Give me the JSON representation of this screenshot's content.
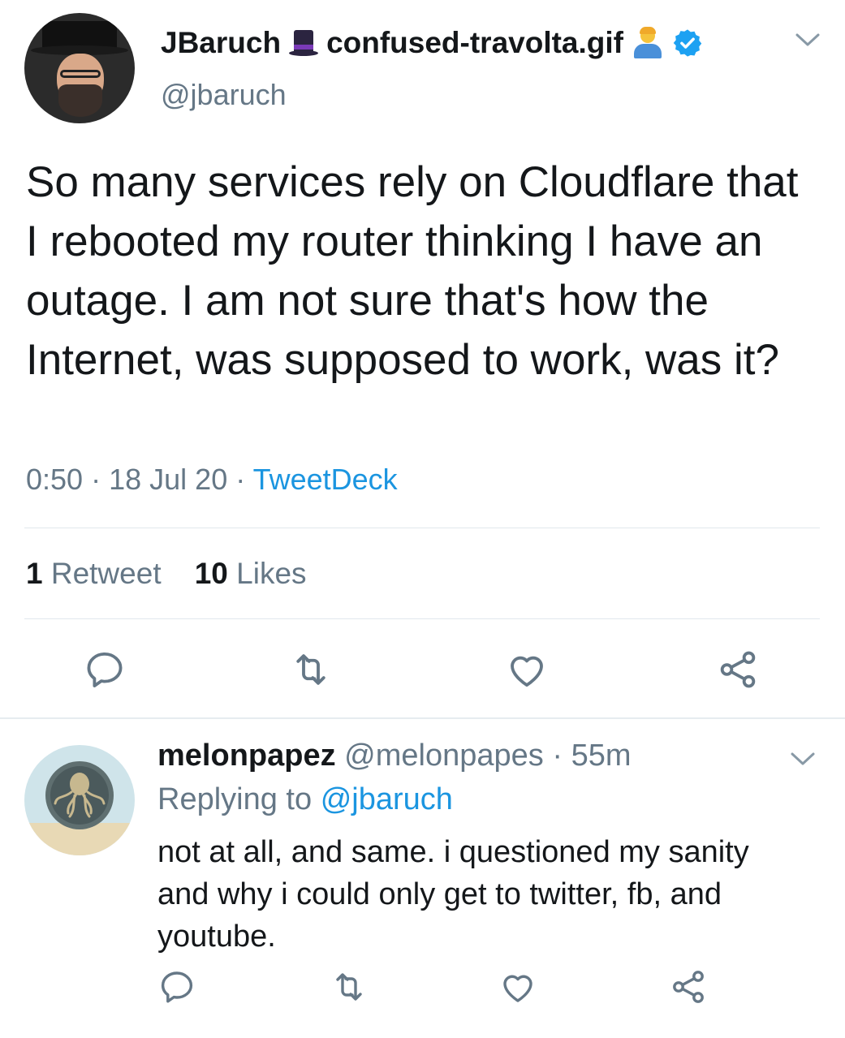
{
  "tweet": {
    "display_name": "JBaruch",
    "display_name_suffix": "confused-travolta.gif",
    "handle": "@jbaruch",
    "text": "So many services rely on Cloudflare that I rebooted my router thinking I have an outage. I am not sure that's how the Internet, was supposed to work, was it?",
    "time": "0:50",
    "date": "18 Jul 20",
    "source": "TweetDeck",
    "separator": "·",
    "retweet_count": "1",
    "retweet_label": "Retweet",
    "like_count": "10",
    "like_label": "Likes",
    "icons": [
      "tophat-icon",
      "person-gesturing-icon",
      "verified-badge-icon",
      "chevron-down-icon",
      "reply-icon",
      "retweet-icon",
      "like-icon",
      "share-icon"
    ]
  },
  "reply": {
    "display_name": "melonpapez",
    "handle": "@melonpapes",
    "separator": "·",
    "age": "55m",
    "replying_prefix": "Replying to",
    "replying_to": "@jbaruch",
    "text": "not at all, and same. i questioned my sanity and why i could only get to twitter, fb, and youtube."
  },
  "colors": {
    "text": "#14171a",
    "secondary": "#657786",
    "link": "#1b95e0",
    "divider": "#e1e8ed",
    "verified": "#1da1f2"
  }
}
